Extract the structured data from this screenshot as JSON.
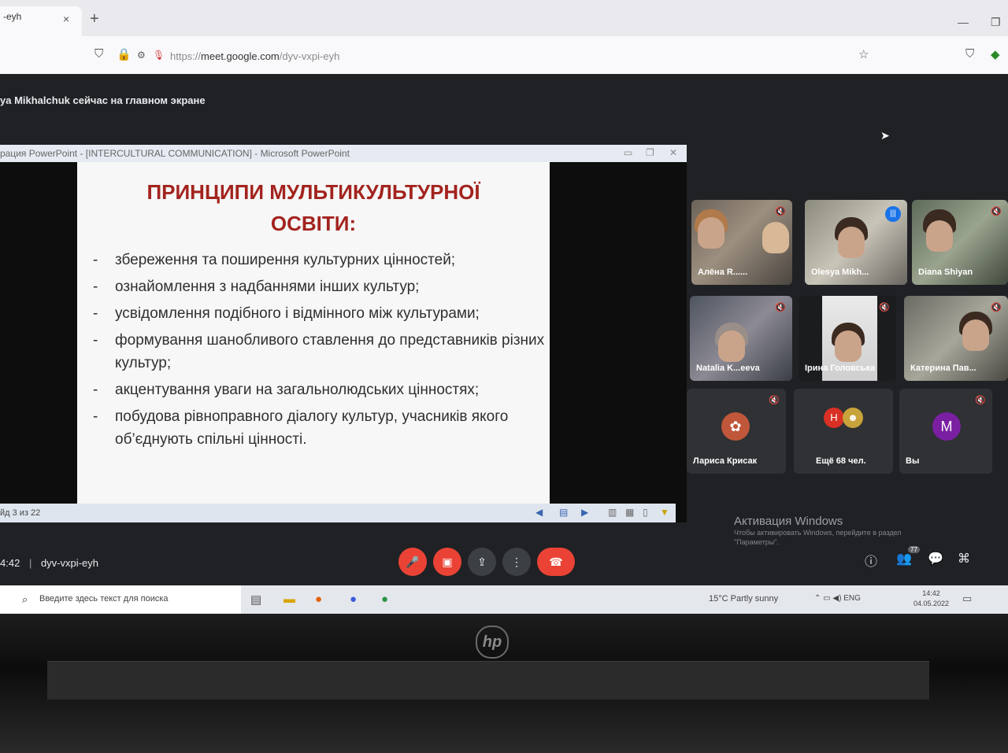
{
  "browser": {
    "tab_title": "-eyh",
    "tab_close": "×",
    "new_tab": "+",
    "url_prefix": "https://",
    "url_host": "meet.google.com",
    "url_path": "/dyv-vxpi-eyh"
  },
  "meet": {
    "presenting_banner": "ya Mikhalchuk сейчас на главном экране",
    "meeting_time": "4:42",
    "meeting_code": "dyv-vxpi-eyh",
    "participants_count": "77"
  },
  "powerpoint": {
    "window_title": "рация PowerPoint - [INTERCULTURAL COMMUNICATION] - Microsoft PowerPoint",
    "slide_counter": "йд 3 из 22",
    "slide": {
      "title_line1": "ПРИНЦИПИ МУЛЬТИКУЛЬТУРНОЇ",
      "title_line2": "ОСВІТИ:",
      "bullets": [
        "збереження та поширення культурних цінностей;",
        "ознайомлення з надбаннями інших культур;",
        "усвідомлення подібного і відмінного між культурами;",
        "формування шанобливого ставлення до представників різних культур;",
        "акцентування уваги на загальнолюдських цінностях;",
        "побудова рівноправного діалогу культур, учасників якого об’єднують спільні цінності."
      ]
    }
  },
  "participants": [
    {
      "name": "Алёна R......",
      "muted": true,
      "speaking": false
    },
    {
      "name": "Olesya Mikh...",
      "muted": false,
      "speaking": true
    },
    {
      "name": "Diana Shiyan",
      "muted": true,
      "speaking": false
    },
    {
      "name": "Natalia K...eeva",
      "muted": true,
      "speaking": false
    },
    {
      "name": "Ірина Головська",
      "muted": true,
      "speaking": false
    },
    {
      "name": "Катерина Пав...",
      "muted": true,
      "speaking": false
    },
    {
      "name": "Лариса Крисак",
      "muted": true,
      "speaking": false
    },
    {
      "name": "Ещё 68 чел.",
      "muted": false,
      "speaking": false
    },
    {
      "name": "Вы",
      "avatar_letter": "M",
      "muted": true,
      "speaking": false
    }
  ],
  "more_avatar_letter": "H",
  "windows_activation": {
    "title": "Активация Windows",
    "line1": "Чтобы активировать Windows, перейдите в раздел",
    "line2": "\"Параметры\"."
  },
  "taskbar": {
    "search_placeholder": "Введите здесь текст для поиска",
    "weather": "15°C  Partly sunny",
    "language": "ENG",
    "time": "14:42",
    "date": "04.05.2022"
  },
  "laptop_brand": "hp",
  "colors": {
    "slide_title": "#a3231e",
    "meet_bg": "#202124",
    "hangup": "#ea4335",
    "active_speaker": "#8ab4f8"
  }
}
